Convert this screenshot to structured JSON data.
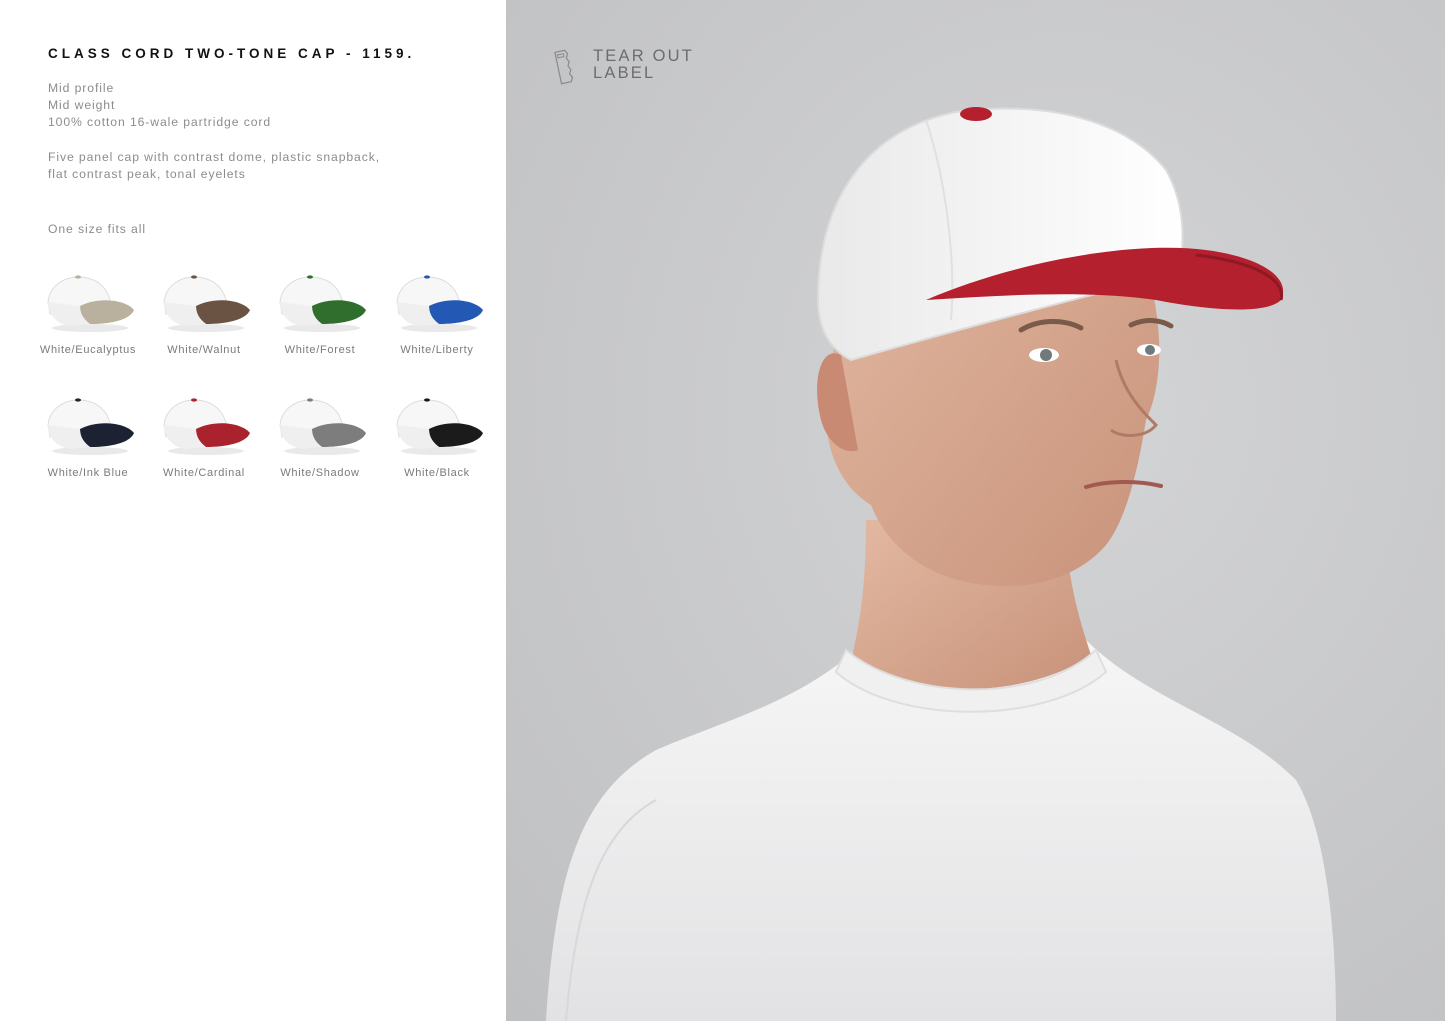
{
  "product": {
    "title": "CLASS CORD TWO-TONE CAP - 1159.",
    "specs": [
      "Mid profile",
      "Mid weight",
      "100% cotton 16-wale partridge cord"
    ],
    "description": [
      "Five panel cap with contrast dome, plastic snapback,",
      "flat contrast peak, tonal eyelets"
    ],
    "size": "One size fits all"
  },
  "colourways": [
    {
      "label": "White/Eucalyptus",
      "peak": "#b9b19e"
    },
    {
      "label": "White/Walnut",
      "peak": "#6b5343"
    },
    {
      "label": "White/Forest",
      "peak": "#2f6e2c"
    },
    {
      "label": "White/Liberty",
      "peak": "#2358b5"
    },
    {
      "label": "White/Ink Blue",
      "peak": "#1d2233"
    },
    {
      "label": "White/Cardinal",
      "peak": "#a9222d"
    },
    {
      "label": "White/Shadow",
      "peak": "#7d7d7d"
    },
    {
      "label": "White/Black",
      "peak": "#1b1b1b"
    }
  ],
  "tear_out": {
    "line1": "TEAR OUT",
    "line2": "LABEL"
  },
  "icons": {
    "tear_out": "tear-label-icon"
  },
  "colors": {
    "cap_peak": "#b5202f",
    "background": "#c9cacc"
  }
}
